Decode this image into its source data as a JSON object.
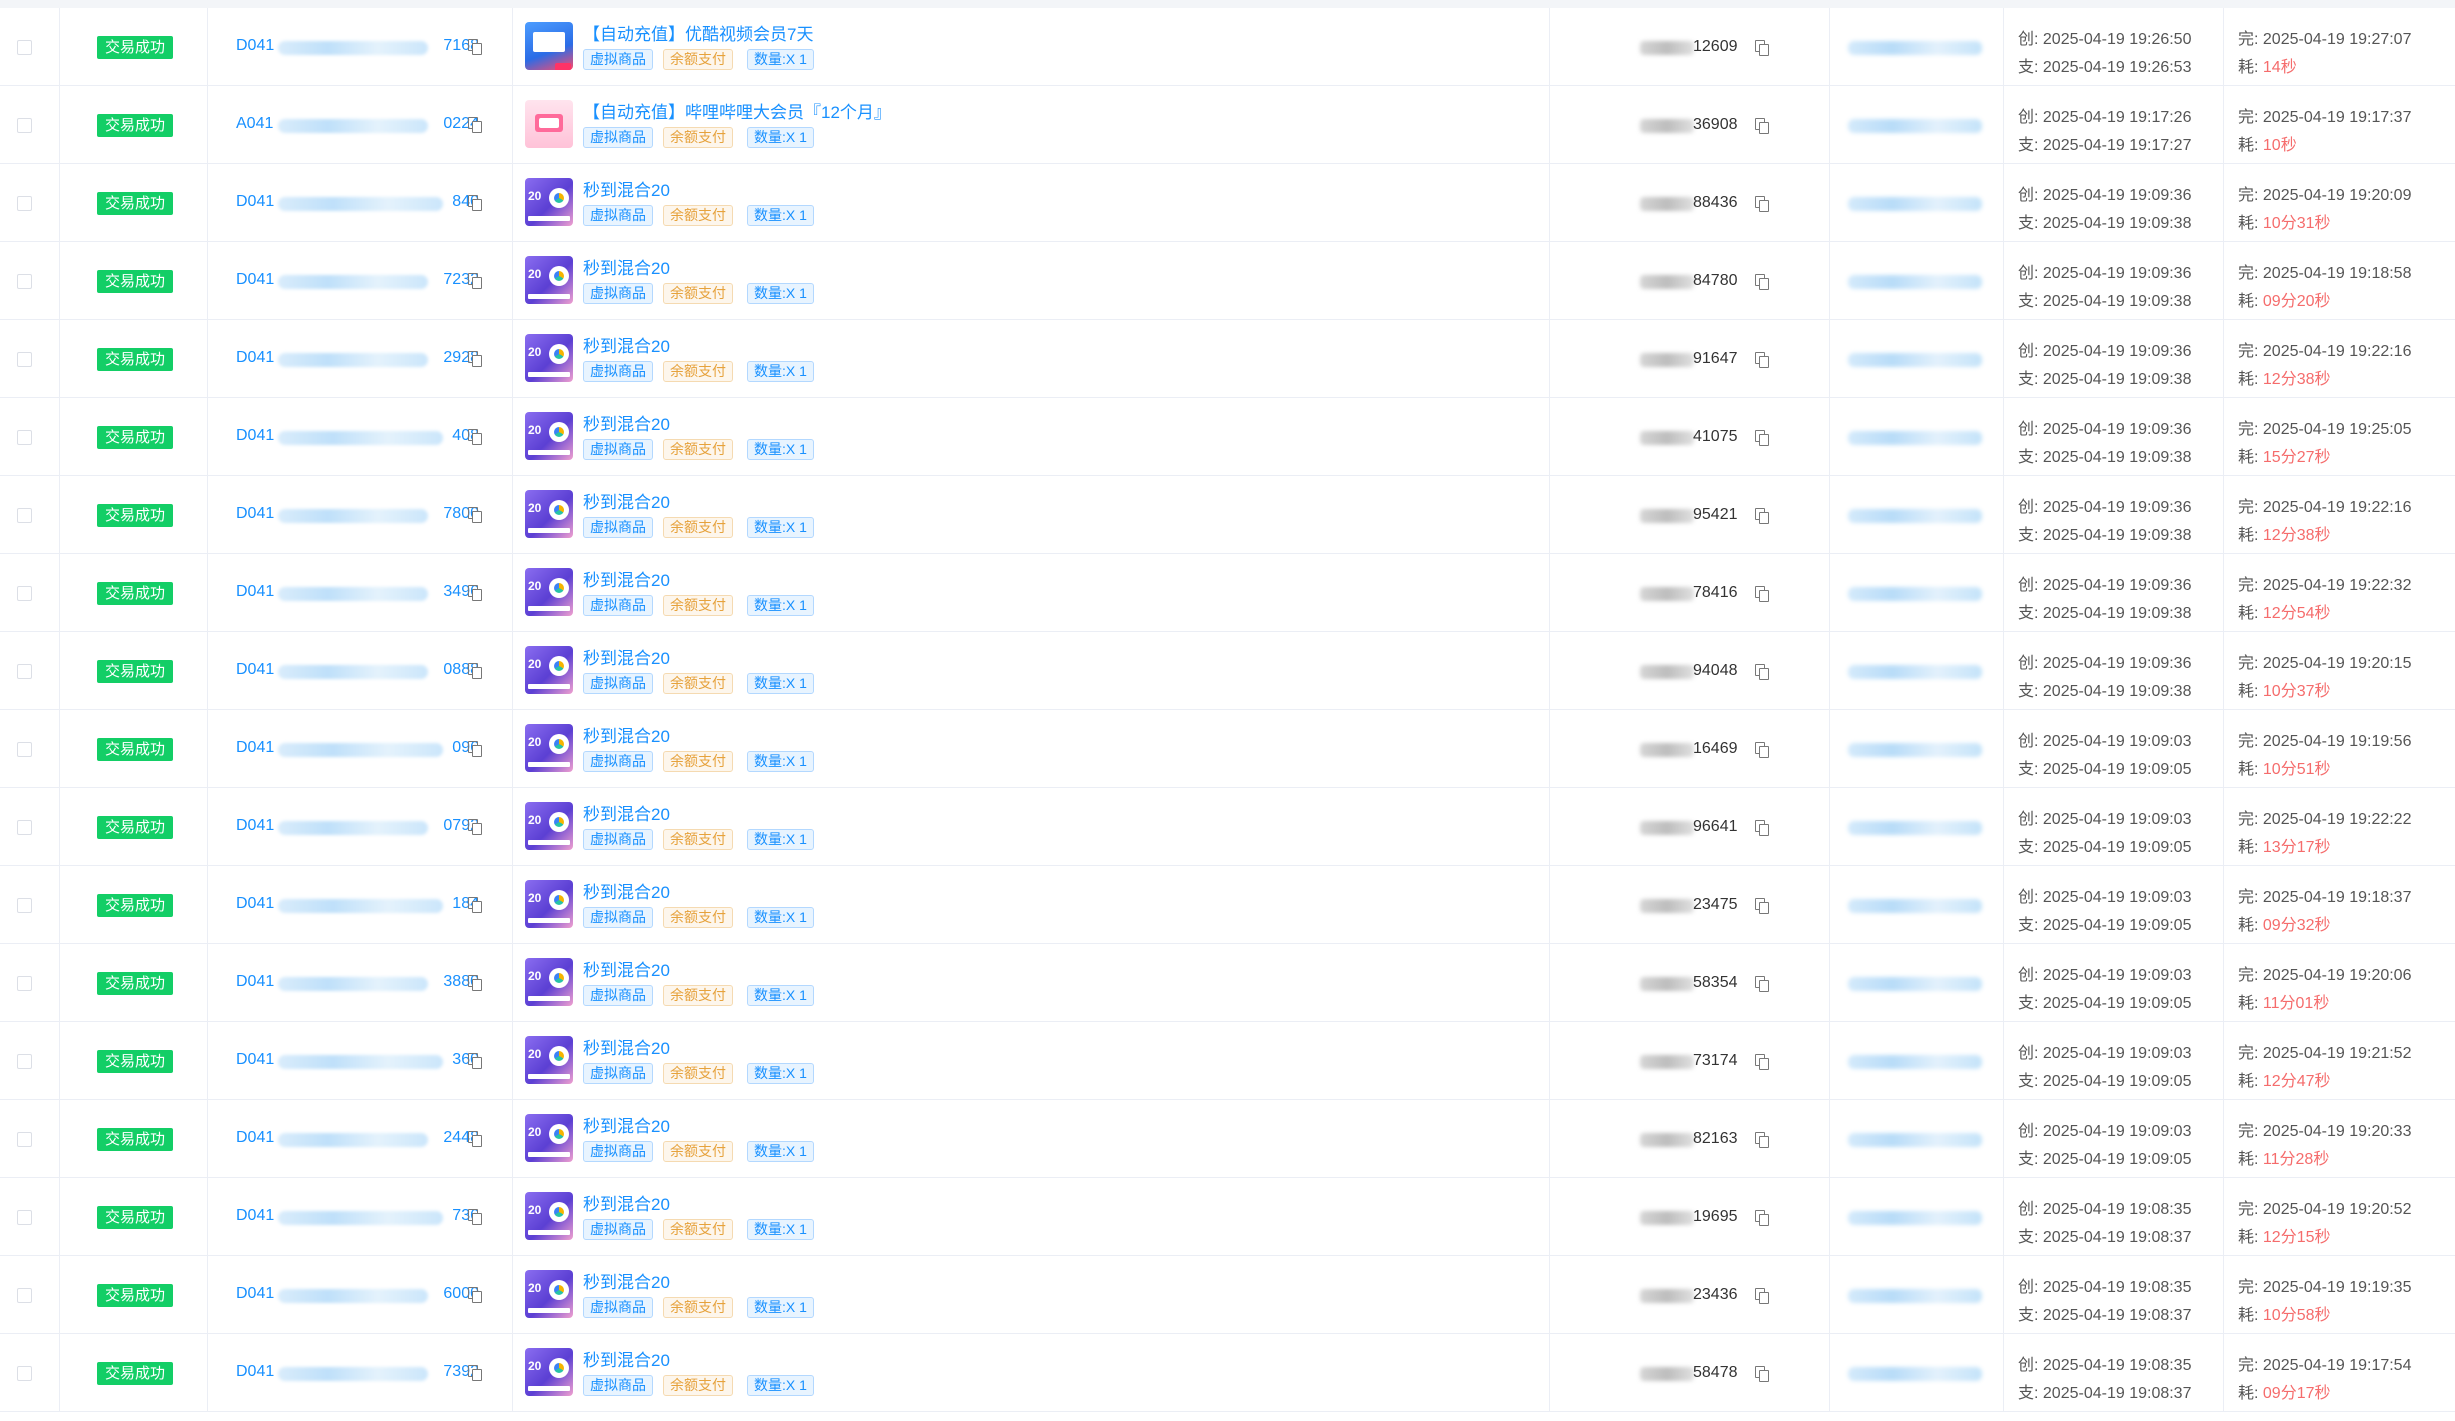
{
  "labels": {
    "status": "交易成功",
    "tag_virtual": "虚拟商品",
    "tag_balance": "余额支付",
    "qty": "数量:X 1",
    "created_prefix": "创:",
    "paid_prefix": "支:",
    "done_prefix": "完:",
    "elapsed_prefix": "耗:"
  },
  "rows": [
    {
      "order_prefix": "D041",
      "order_suffix": "7168",
      "goods": "【自动充值】优酷视频会员7天",
      "thumb": "youku",
      "account_suffix": "12609",
      "created": "2025-04-19 19:26:50",
      "paid": "2025-04-19 19:26:53",
      "done": "2025-04-19 19:27:07",
      "elapsed": "14秒"
    },
    {
      "order_prefix": "A041",
      "order_suffix": "0224",
      "goods": "【自动充值】哔哩哔哩大会员『12个月』",
      "thumb": "bili",
      "account_suffix": "36908",
      "created": "2025-04-19 19:17:26",
      "paid": "2025-04-19 19:17:27",
      "done": "2025-04-19 19:17:37",
      "elapsed": "10秒"
    },
    {
      "order_prefix": "D041",
      "order_suffix": "840",
      "goods": "秒到混合20",
      "thumb": "mix",
      "account_suffix": "88436",
      "created": "2025-04-19 19:09:36",
      "paid": "2025-04-19 19:09:38",
      "done": "2025-04-19 19:20:09",
      "elapsed": "10分31秒"
    },
    {
      "order_prefix": "D041",
      "order_suffix": "7232",
      "goods": "秒到混合20",
      "thumb": "mix",
      "account_suffix": "84780",
      "created": "2025-04-19 19:09:36",
      "paid": "2025-04-19 19:09:38",
      "done": "2025-04-19 19:18:58",
      "elapsed": "09分20秒"
    },
    {
      "order_prefix": "D041",
      "order_suffix": "2928",
      "goods": "秒到混合20",
      "thumb": "mix",
      "account_suffix": "91647",
      "created": "2025-04-19 19:09:36",
      "paid": "2025-04-19 19:09:38",
      "done": "2025-04-19 19:22:16",
      "elapsed": "12分38秒"
    },
    {
      "order_prefix": "D041",
      "order_suffix": "408",
      "goods": "秒到混合20",
      "thumb": "mix",
      "account_suffix": "41075",
      "created": "2025-04-19 19:09:36",
      "paid": "2025-04-19 19:09:38",
      "done": "2025-04-19 19:25:05",
      "elapsed": "15分27秒"
    },
    {
      "order_prefix": "D041",
      "order_suffix": "7800",
      "goods": "秒到混合20",
      "thumb": "mix",
      "account_suffix": "95421",
      "created": "2025-04-19 19:09:36",
      "paid": "2025-04-19 19:09:38",
      "done": "2025-04-19 19:22:16",
      "elapsed": "12分38秒"
    },
    {
      "order_prefix": "D041",
      "order_suffix": "3496",
      "goods": "秒到混合20",
      "thumb": "mix",
      "account_suffix": "78416",
      "created": "2025-04-19 19:09:36",
      "paid": "2025-04-19 19:09:38",
      "done": "2025-04-19 19:22:32",
      "elapsed": "12分54秒"
    },
    {
      "order_prefix": "D041",
      "order_suffix": "0888",
      "goods": "秒到混合20",
      "thumb": "mix",
      "account_suffix": "94048",
      "created": "2025-04-19 19:09:36",
      "paid": "2025-04-19 19:09:38",
      "done": "2025-04-19 19:20:15",
      "elapsed": "10分37秒"
    },
    {
      "order_prefix": "D041",
      "order_suffix": "096",
      "goods": "秒到混合20",
      "thumb": "mix",
      "account_suffix": "16469",
      "created": "2025-04-19 19:09:03",
      "paid": "2025-04-19 19:09:05",
      "done": "2025-04-19 19:19:56",
      "elapsed": "10分51秒"
    },
    {
      "order_prefix": "D041",
      "order_suffix": "0792",
      "goods": "秒到混合20",
      "thumb": "mix",
      "account_suffix": "96641",
      "created": "2025-04-19 19:09:03",
      "paid": "2025-04-19 19:09:05",
      "done": "2025-04-19 19:22:22",
      "elapsed": "13分17秒"
    },
    {
      "order_prefix": "D041",
      "order_suffix": "184",
      "goods": "秒到混合20",
      "thumb": "mix",
      "account_suffix": "23475",
      "created": "2025-04-19 19:09:03",
      "paid": "2025-04-19 19:09:05",
      "done": "2025-04-19 19:18:37",
      "elapsed": "09分32秒"
    },
    {
      "order_prefix": "D041",
      "order_suffix": "3880",
      "goods": "秒到混合20",
      "thumb": "mix",
      "account_suffix": "58354",
      "created": "2025-04-19 19:09:03",
      "paid": "2025-04-19 19:09:05",
      "done": "2025-04-19 19:20:06",
      "elapsed": "11分01秒"
    },
    {
      "order_prefix": "D041",
      "order_suffix": "360",
      "goods": "秒到混合20",
      "thumb": "mix",
      "account_suffix": "73174",
      "created": "2025-04-19 19:09:03",
      "paid": "2025-04-19 19:09:05",
      "done": "2025-04-19 19:21:52",
      "elapsed": "12分47秒"
    },
    {
      "order_prefix": "D041",
      "order_suffix": "2448",
      "goods": "秒到混合20",
      "thumb": "mix",
      "account_suffix": "82163",
      "created": "2025-04-19 19:09:03",
      "paid": "2025-04-19 19:09:05",
      "done": "2025-04-19 19:20:33",
      "elapsed": "11分28秒"
    },
    {
      "order_prefix": "D041",
      "order_suffix": "736",
      "goods": "秒到混合20",
      "thumb": "mix",
      "account_suffix": "19695",
      "created": "2025-04-19 19:08:35",
      "paid": "2025-04-19 19:08:37",
      "done": "2025-04-19 19:20:52",
      "elapsed": "12分15秒"
    },
    {
      "order_prefix": "D041",
      "order_suffix": "6000",
      "goods": "秒到混合20",
      "thumb": "mix",
      "account_suffix": "23436",
      "created": "2025-04-19 19:08:35",
      "paid": "2025-04-19 19:08:37",
      "done": "2025-04-19 19:19:35",
      "elapsed": "10分58秒"
    },
    {
      "order_prefix": "D041",
      "order_suffix": "7392",
      "goods": "秒到混合20",
      "thumb": "mix",
      "account_suffix": "58478",
      "created": "2025-04-19 19:08:35",
      "paid": "2025-04-19 19:08:37",
      "done": "2025-04-19 19:17:54",
      "elapsed": "09分17秒"
    }
  ]
}
